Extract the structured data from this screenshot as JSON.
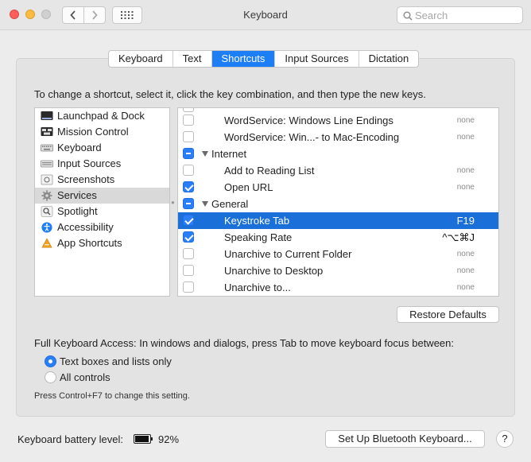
{
  "window": {
    "title": "Keyboard"
  },
  "search": {
    "placeholder": "Search"
  },
  "tabs": [
    {
      "label": "Keyboard",
      "active": false
    },
    {
      "label": "Text",
      "active": false
    },
    {
      "label": "Shortcuts",
      "active": true
    },
    {
      "label": "Input Sources",
      "active": false
    },
    {
      "label": "Dictation",
      "active": false
    }
  ],
  "instructions": "To change a shortcut, select it, click the key combination, and then type the new keys.",
  "categories": [
    {
      "label": "Launchpad & Dock",
      "icon": "launchpad-dock-icon",
      "selected": false
    },
    {
      "label": "Mission Control",
      "icon": "mission-control-icon",
      "selected": false
    },
    {
      "label": "Keyboard",
      "icon": "keyboard-icon",
      "selected": false
    },
    {
      "label": "Input Sources",
      "icon": "input-sources-icon",
      "selected": false
    },
    {
      "label": "Screenshots",
      "icon": "screenshots-icon",
      "selected": false
    },
    {
      "label": "Services",
      "icon": "gear-icon",
      "selected": true
    },
    {
      "label": "Spotlight",
      "icon": "spotlight-icon",
      "selected": false
    },
    {
      "label": "Accessibility",
      "icon": "accessibility-icon",
      "selected": false
    },
    {
      "label": "App Shortcuts",
      "icon": "app-shortcuts-icon",
      "selected": false
    }
  ],
  "shortcuts": [
    {
      "type": "item",
      "label": "WordService: Windows Line Endings",
      "checked": false,
      "shortcut": "none"
    },
    {
      "type": "item",
      "label": "WordService: Win...- to Mac-Encoding",
      "checked": false,
      "shortcut": "none"
    },
    {
      "type": "group",
      "label": "Internet",
      "state": "mixed"
    },
    {
      "type": "item",
      "label": "Add to Reading List",
      "checked": false,
      "shortcut": "none"
    },
    {
      "type": "item",
      "label": "Open URL",
      "checked": true,
      "shortcut": "none"
    },
    {
      "type": "group",
      "label": "General",
      "state": "mixed"
    },
    {
      "type": "item",
      "label": "Keystroke Tab",
      "checked": true,
      "shortcut": "F19",
      "highlighted": true
    },
    {
      "type": "item",
      "label": "Speaking Rate",
      "checked": true,
      "shortcut": "^⌥⌘J"
    },
    {
      "type": "item",
      "label": "Unarchive to Current Folder",
      "checked": false,
      "shortcut": "none"
    },
    {
      "type": "item",
      "label": "Unarchive to Desktop",
      "checked": false,
      "shortcut": "none"
    },
    {
      "type": "item",
      "label": "Unarchive to...",
      "checked": false,
      "shortcut": "none"
    }
  ],
  "restore_defaults": "Restore Defaults",
  "full_keyboard_access": {
    "label": "Full Keyboard Access: In windows and dialogs, press Tab to move keyboard focus between:",
    "options": [
      {
        "label": "Text boxes and lists only",
        "selected": true
      },
      {
        "label": "All controls",
        "selected": false
      }
    ],
    "hint": "Press Control+F7 to change this setting."
  },
  "battery": {
    "label": "Keyboard battery level:",
    "percent": "92%",
    "level": 0.92
  },
  "bluetooth_button": "Set Up Bluetooth Keyboard...",
  "help_button": "?",
  "colors": {
    "accent": "#1e7ef6",
    "highlight_row": "#1a6fd8",
    "selected_category": "#d9d9d9"
  }
}
